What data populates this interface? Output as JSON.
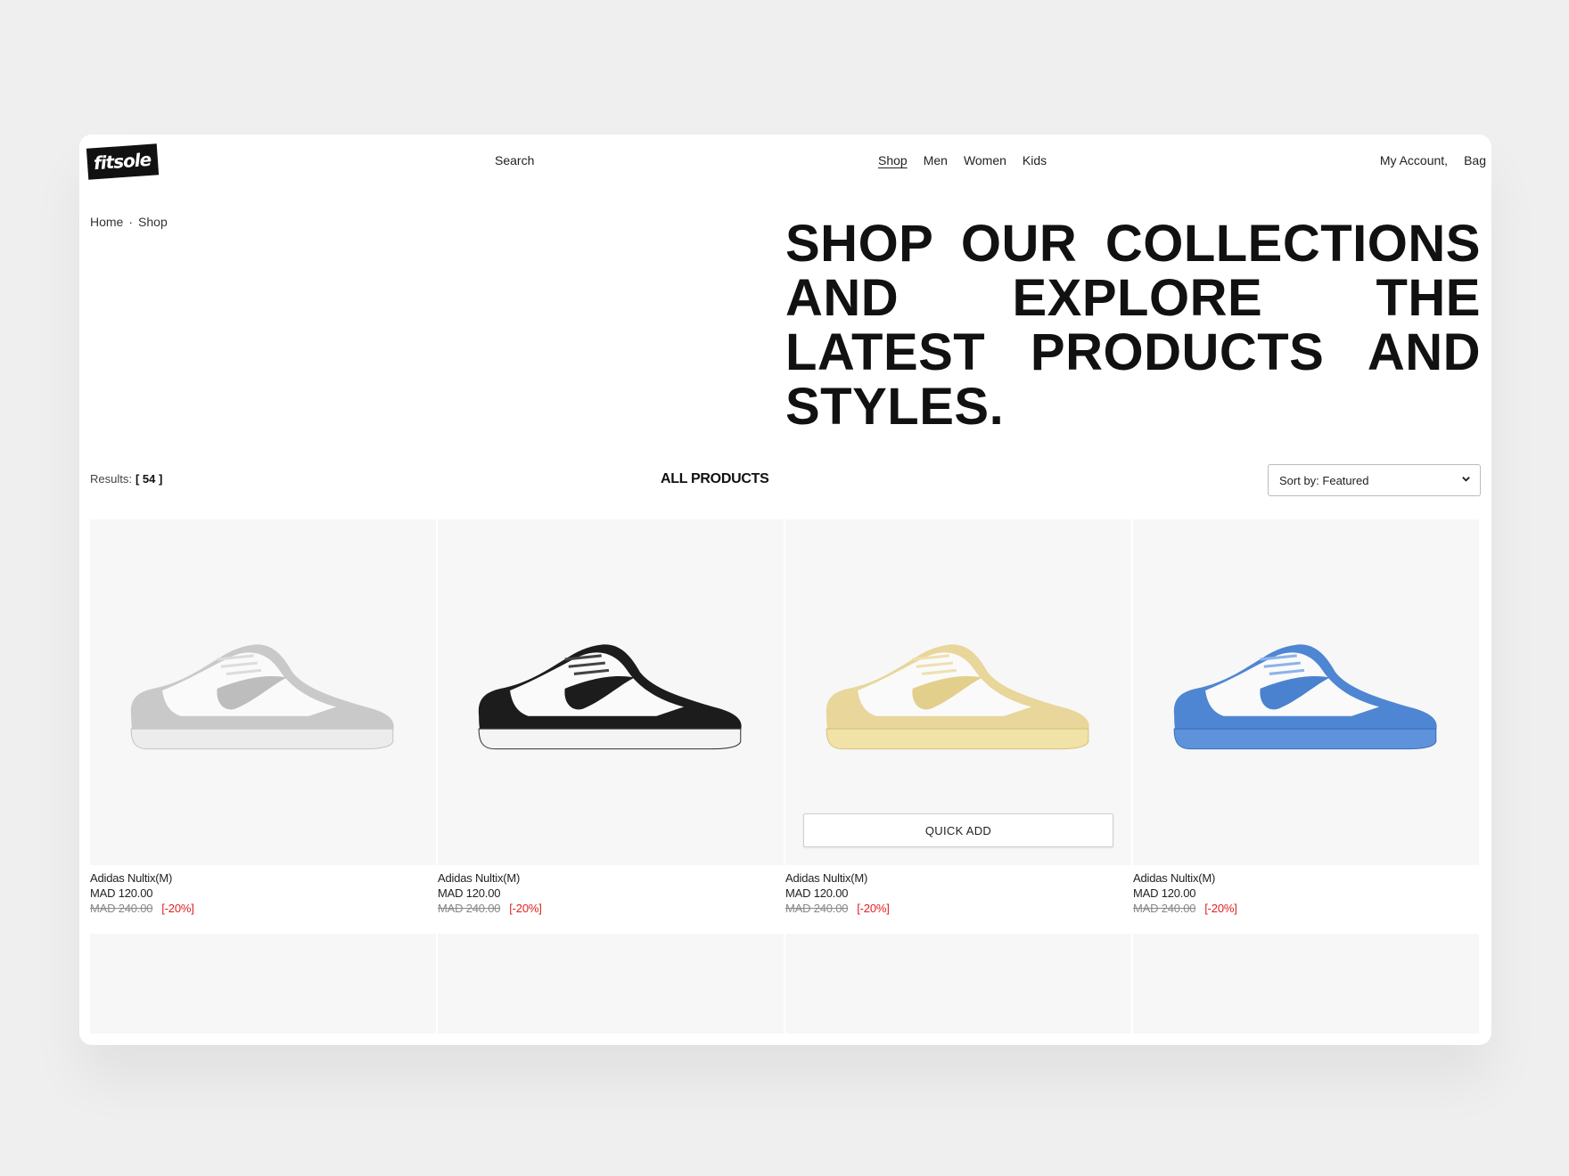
{
  "header": {
    "logo": "fitsole",
    "search_label": "Search",
    "nav": [
      {
        "label": "Shop",
        "active": true
      },
      {
        "label": "Men",
        "active": false
      },
      {
        "label": "Women",
        "active": false
      },
      {
        "label": "Kids",
        "active": false
      }
    ],
    "account_label": "My Account,",
    "bag_label": "Bag"
  },
  "breadcrumb": {
    "home": "Home",
    "separator": "·",
    "current": "Shop"
  },
  "hero": {
    "headline": "SHOP OUR COLLECTIONS AND EXPLORE THE LATEST PRODUCTS AND STYLES."
  },
  "toolbar": {
    "results_label": "Results:",
    "results_count": "[ 54 ]",
    "section_title": "ALL PRODUCTS",
    "sort_label": "Sort by: Featured"
  },
  "products": [
    {
      "name": "Adidas Nultix(M)",
      "price": "MAD 120.00",
      "old_price": "MAD 240.00",
      "discount": "[-20%]",
      "colorway": "grey"
    },
    {
      "name": "Adidas Nultix(M)",
      "price": "MAD 120.00",
      "old_price": "MAD 240.00",
      "discount": "[-20%]",
      "colorway": "black"
    },
    {
      "name": "Adidas Nultix(M)",
      "price": "MAD 120.00",
      "old_price": "MAD 240.00",
      "discount": "[-20%]",
      "colorway": "yellow",
      "quick_add": "QUICK ADD"
    },
    {
      "name": "Adidas Nultix(M)",
      "price": "MAD 120.00",
      "old_price": "MAD 240.00",
      "discount": "[-20%]",
      "colorway": "blue"
    }
  ],
  "colors": {
    "discount": "#e02020",
    "card_bg": "#f7f7f7",
    "page_bg": "#efefef",
    "grey_overlay": "#c9c9c9",
    "black_overlay": "#1c1c1c",
    "yellow_overlay": "#e8d69a",
    "blue_overlay": "#4f86d3"
  },
  "icons": {
    "sort_chevron": "chevron-down-icon"
  }
}
